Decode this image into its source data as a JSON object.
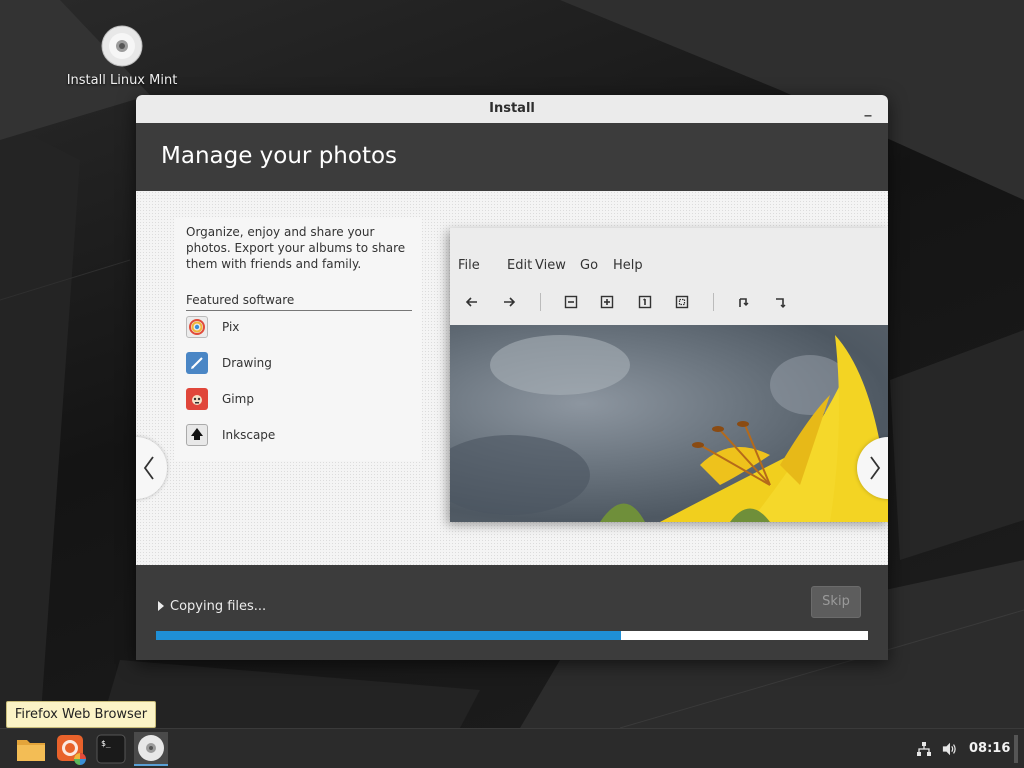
{
  "desktop": {
    "icon_label": "Install Linux Mint"
  },
  "window": {
    "title": "Install",
    "minimize_glyph": "_",
    "heading": "Manage your photos"
  },
  "slide": {
    "description": "Organize, enjoy and share your photos. Export your albums to share them with friends and family.",
    "featured_label": "Featured software",
    "apps": [
      {
        "name": "Pix",
        "icon": "pix-icon"
      },
      {
        "name": "Drawing",
        "icon": "drawing-icon"
      },
      {
        "name": "Gimp",
        "icon": "gimp-icon"
      },
      {
        "name": "Inkscape",
        "icon": "inkscape-icon"
      }
    ],
    "screenshot_menu": [
      "File",
      "Edit",
      "View",
      "Go",
      "Help"
    ]
  },
  "status": {
    "text": "Copying files...",
    "skip_label": "Skip",
    "progress_fraction": 0.653
  },
  "tooltip": {
    "text": "Firefox Web Browser"
  },
  "taskbar": {
    "clock": "08:16"
  },
  "colors": {
    "accent": "#1f8fd6",
    "window_dark": "#3c3c3c",
    "tooltip_bg": "#fbf3c6"
  }
}
